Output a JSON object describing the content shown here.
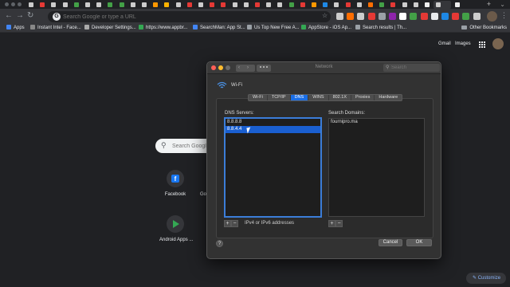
{
  "browser": {
    "omnibox_placeholder": "Search Google or type a URL",
    "bookmarks": [
      {
        "label": "Apps",
        "color": "#4285f4"
      },
      {
        "label": "Instant Intel - Face...",
        "color": "#888888"
      },
      {
        "label": "Developer Settings...",
        "color": "#aaaaaa"
      },
      {
        "label": "https://www.appbr...",
        "color": "#34a853"
      },
      {
        "label": "SearchMan: App St...",
        "color": "#4285f4"
      },
      {
        "label": "Us Top New Free A...",
        "color": "#9aa0a6"
      },
      {
        "label": "AppStore - iOS Ap...",
        "color": "#34a853"
      },
      {
        "label": "Search results | Th...",
        "color": "#9aa0a6"
      }
    ],
    "other_bookmarks": "Other Bookmarks",
    "extension_colors": [
      "#cccccc",
      "#ff6d00",
      "#cccccc",
      "#e53935",
      "#9aa0a6",
      "#8e24aa",
      "#ffffff",
      "#43a047",
      "#e53935",
      "#e8eaed",
      "#1e88e5",
      "#e53935",
      "#43a047",
      "#cccccc"
    ]
  },
  "ntp": {
    "gmail": "Gmail",
    "images": "Images",
    "search_placeholder": "Search Google",
    "tiles": [
      {
        "label": "Facebook",
        "icon": "facebook-icon"
      },
      {
        "label": "Go",
        "icon": "google-icon"
      },
      {
        "label": "Android Apps ...",
        "icon": "play-store-icon"
      }
    ],
    "customize": "Customize"
  },
  "dialog": {
    "title": "Network",
    "search_placeholder": "Search",
    "interface_name": "Wi-Fi",
    "tabs": [
      {
        "label": "Wi-Fi",
        "selected": false
      },
      {
        "label": "TCP/IP",
        "selected": false
      },
      {
        "label": "DNS",
        "selected": true
      },
      {
        "label": "WINS",
        "selected": false
      },
      {
        "label": "802.1X",
        "selected": false
      },
      {
        "label": "Proxies",
        "selected": false
      },
      {
        "label": "Hardware",
        "selected": false
      }
    ],
    "dns_servers_label": "DNS Servers:",
    "dns_servers": [
      {
        "value": "8.8.8.8",
        "selected": false
      },
      {
        "value": "8.8.4.4",
        "selected": true
      }
    ],
    "search_domains_label": "Search Domains:",
    "search_domains": [
      "fournipro.ma"
    ],
    "add": "+",
    "remove": "−",
    "hint": "IPv4 or IPv6 addresses",
    "help": "?",
    "cancel": "Cancel",
    "ok": "OK"
  }
}
